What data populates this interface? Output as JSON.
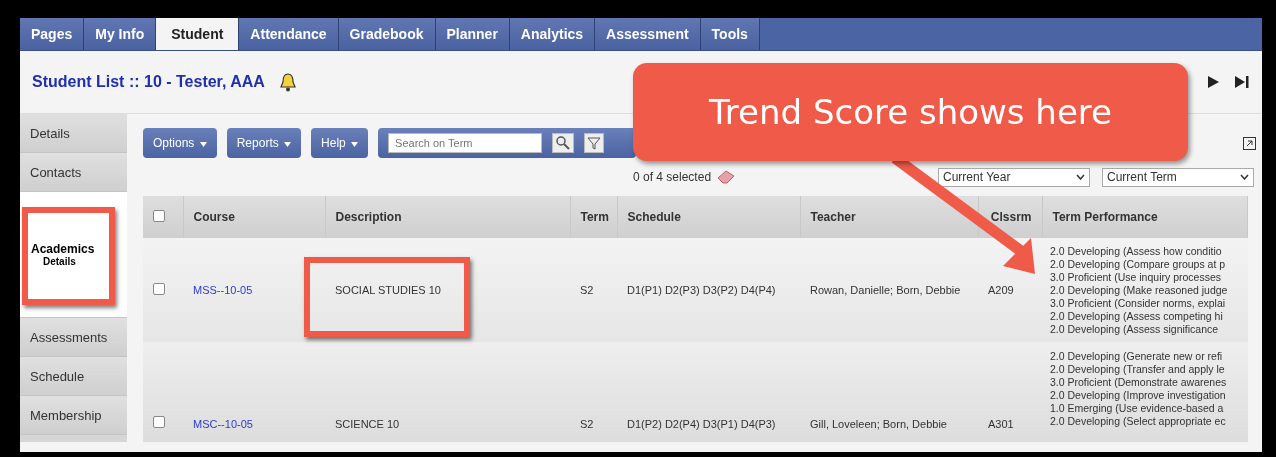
{
  "tabs": [
    {
      "label": "Pages",
      "selected": false
    },
    {
      "label": "My Info",
      "selected": false
    },
    {
      "label": "Student",
      "selected": true
    },
    {
      "label": "Attendance",
      "selected": false
    },
    {
      "label": "Gradebook",
      "selected": false
    },
    {
      "label": "Planner",
      "selected": false
    },
    {
      "label": "Analytics",
      "selected": false
    },
    {
      "label": "Assessment",
      "selected": false
    },
    {
      "label": "Tools",
      "selected": false
    }
  ],
  "header": {
    "title": "Student List :: 10 - Tester, AAA"
  },
  "sidebar": {
    "items": [
      {
        "label": "Details",
        "selected": false
      },
      {
        "label": "Contacts",
        "selected": false
      },
      {
        "label": "Academics",
        "sublabel": "Details",
        "selected": true
      },
      {
        "label": "Assessments",
        "selected": false
      },
      {
        "label": "Schedule",
        "selected": false
      },
      {
        "label": "Membership",
        "selected": false
      }
    ]
  },
  "toolbar": {
    "buttons": [
      "Options",
      "Reports",
      "Help"
    ],
    "search": {
      "placeholder": "Search on Term"
    }
  },
  "selection": {
    "count": "0 of 4 selected",
    "filters": [
      "Current Year",
      "Current Term"
    ]
  },
  "table": {
    "all_checked": false,
    "columns": [
      "Course",
      "Description",
      "Term",
      "Schedule",
      "Teacher",
      "Clssrm",
      "Term Performance"
    ],
    "rows": [
      {
        "checked": false,
        "course": "MSS--10-05",
        "description": "SOCIAL STUDIES 10",
        "term": "S2",
        "schedule": "D1(P1) D2(P3) D3(P2) D4(P4)",
        "teacher": "Rowan, Danielle; Born, Debbie",
        "room": "A209",
        "performance": [
          "2.0 Developing (Assess how conditio",
          "2.0 Developing (Compare groups at p",
          "3.0 Proficient (Use inquiry processes",
          "2.0 Developing (Make reasoned judge",
          "3.0 Proficient (Consider norms, explai",
          "2.0 Developing (Assess competing hi",
          "2.0 Developing (Assess significance"
        ]
      },
      {
        "checked": false,
        "course": "MSC--10-05",
        "description": "SCIENCE 10",
        "term": "S2",
        "schedule": "D1(P2) D2(P4) D3(P1) D4(P3)",
        "teacher": "Gill, Loveleen; Born, Debbie",
        "room": "A301",
        "performance": [
          "2.0 Developing (Generate new or refi",
          "2.0 Developing (Transfer and apply le",
          "3.0 Proficient (Demonstrate awarenes",
          "2.0 Developing (Improve investigation",
          "1.0 Emerging (Use evidence-based a",
          "2.0 Developing (Select appropriate ec"
        ]
      }
    ]
  },
  "annotation": {
    "callout": "Trend Score shows here"
  }
}
